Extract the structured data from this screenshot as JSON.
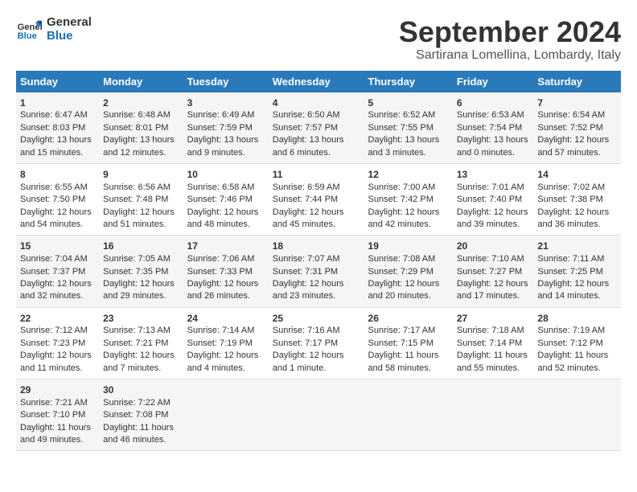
{
  "header": {
    "logo_line1": "General",
    "logo_line2": "Blue",
    "title": "September 2024",
    "subtitle": "Sartirana Lomellina, Lombardy, Italy"
  },
  "days_of_week": [
    "Sunday",
    "Monday",
    "Tuesday",
    "Wednesday",
    "Thursday",
    "Friday",
    "Saturday"
  ],
  "weeks": [
    [
      {
        "day": "1",
        "sunrise": "Sunrise: 6:47 AM",
        "sunset": "Sunset: 8:03 PM",
        "daylight": "Daylight: 13 hours and 15 minutes."
      },
      {
        "day": "2",
        "sunrise": "Sunrise: 6:48 AM",
        "sunset": "Sunset: 8:01 PM",
        "daylight": "Daylight: 13 hours and 12 minutes."
      },
      {
        "day": "3",
        "sunrise": "Sunrise: 6:49 AM",
        "sunset": "Sunset: 7:59 PM",
        "daylight": "Daylight: 13 hours and 9 minutes."
      },
      {
        "day": "4",
        "sunrise": "Sunrise: 6:50 AM",
        "sunset": "Sunset: 7:57 PM",
        "daylight": "Daylight: 13 hours and 6 minutes."
      },
      {
        "day": "5",
        "sunrise": "Sunrise: 6:52 AM",
        "sunset": "Sunset: 7:55 PM",
        "daylight": "Daylight: 13 hours and 3 minutes."
      },
      {
        "day": "6",
        "sunrise": "Sunrise: 6:53 AM",
        "sunset": "Sunset: 7:54 PM",
        "daylight": "Daylight: 13 hours and 0 minutes."
      },
      {
        "day": "7",
        "sunrise": "Sunrise: 6:54 AM",
        "sunset": "Sunset: 7:52 PM",
        "daylight": "Daylight: 12 hours and 57 minutes."
      }
    ],
    [
      {
        "day": "8",
        "sunrise": "Sunrise: 6:55 AM",
        "sunset": "Sunset: 7:50 PM",
        "daylight": "Daylight: 12 hours and 54 minutes."
      },
      {
        "day": "9",
        "sunrise": "Sunrise: 6:56 AM",
        "sunset": "Sunset: 7:48 PM",
        "daylight": "Daylight: 12 hours and 51 minutes."
      },
      {
        "day": "10",
        "sunrise": "Sunrise: 6:58 AM",
        "sunset": "Sunset: 7:46 PM",
        "daylight": "Daylight: 12 hours and 48 minutes."
      },
      {
        "day": "11",
        "sunrise": "Sunrise: 6:59 AM",
        "sunset": "Sunset: 7:44 PM",
        "daylight": "Daylight: 12 hours and 45 minutes."
      },
      {
        "day": "12",
        "sunrise": "Sunrise: 7:00 AM",
        "sunset": "Sunset: 7:42 PM",
        "daylight": "Daylight: 12 hours and 42 minutes."
      },
      {
        "day": "13",
        "sunrise": "Sunrise: 7:01 AM",
        "sunset": "Sunset: 7:40 PM",
        "daylight": "Daylight: 12 hours and 39 minutes."
      },
      {
        "day": "14",
        "sunrise": "Sunrise: 7:02 AM",
        "sunset": "Sunset: 7:38 PM",
        "daylight": "Daylight: 12 hours and 36 minutes."
      }
    ],
    [
      {
        "day": "15",
        "sunrise": "Sunrise: 7:04 AM",
        "sunset": "Sunset: 7:37 PM",
        "daylight": "Daylight: 12 hours and 32 minutes."
      },
      {
        "day": "16",
        "sunrise": "Sunrise: 7:05 AM",
        "sunset": "Sunset: 7:35 PM",
        "daylight": "Daylight: 12 hours and 29 minutes."
      },
      {
        "day": "17",
        "sunrise": "Sunrise: 7:06 AM",
        "sunset": "Sunset: 7:33 PM",
        "daylight": "Daylight: 12 hours and 26 minutes."
      },
      {
        "day": "18",
        "sunrise": "Sunrise: 7:07 AM",
        "sunset": "Sunset: 7:31 PM",
        "daylight": "Daylight: 12 hours and 23 minutes."
      },
      {
        "day": "19",
        "sunrise": "Sunrise: 7:08 AM",
        "sunset": "Sunset: 7:29 PM",
        "daylight": "Daylight: 12 hours and 20 minutes."
      },
      {
        "day": "20",
        "sunrise": "Sunrise: 7:10 AM",
        "sunset": "Sunset: 7:27 PM",
        "daylight": "Daylight: 12 hours and 17 minutes."
      },
      {
        "day": "21",
        "sunrise": "Sunrise: 7:11 AM",
        "sunset": "Sunset: 7:25 PM",
        "daylight": "Daylight: 12 hours and 14 minutes."
      }
    ],
    [
      {
        "day": "22",
        "sunrise": "Sunrise: 7:12 AM",
        "sunset": "Sunset: 7:23 PM",
        "daylight": "Daylight: 12 hours and 11 minutes."
      },
      {
        "day": "23",
        "sunrise": "Sunrise: 7:13 AM",
        "sunset": "Sunset: 7:21 PM",
        "daylight": "Daylight: 12 hours and 7 minutes."
      },
      {
        "day": "24",
        "sunrise": "Sunrise: 7:14 AM",
        "sunset": "Sunset: 7:19 PM",
        "daylight": "Daylight: 12 hours and 4 minutes."
      },
      {
        "day": "25",
        "sunrise": "Sunrise: 7:16 AM",
        "sunset": "Sunset: 7:17 PM",
        "daylight": "Daylight: 12 hours and 1 minute."
      },
      {
        "day": "26",
        "sunrise": "Sunrise: 7:17 AM",
        "sunset": "Sunset: 7:15 PM",
        "daylight": "Daylight: 11 hours and 58 minutes."
      },
      {
        "day": "27",
        "sunrise": "Sunrise: 7:18 AM",
        "sunset": "Sunset: 7:14 PM",
        "daylight": "Daylight: 11 hours and 55 minutes."
      },
      {
        "day": "28",
        "sunrise": "Sunrise: 7:19 AM",
        "sunset": "Sunset: 7:12 PM",
        "daylight": "Daylight: 11 hours and 52 minutes."
      }
    ],
    [
      {
        "day": "29",
        "sunrise": "Sunrise: 7:21 AM",
        "sunset": "Sunset: 7:10 PM",
        "daylight": "Daylight: 11 hours and 49 minutes."
      },
      {
        "day": "30",
        "sunrise": "Sunrise: 7:22 AM",
        "sunset": "Sunset: 7:08 PM",
        "daylight": "Daylight: 11 hours and 46 minutes."
      },
      null,
      null,
      null,
      null,
      null
    ]
  ]
}
